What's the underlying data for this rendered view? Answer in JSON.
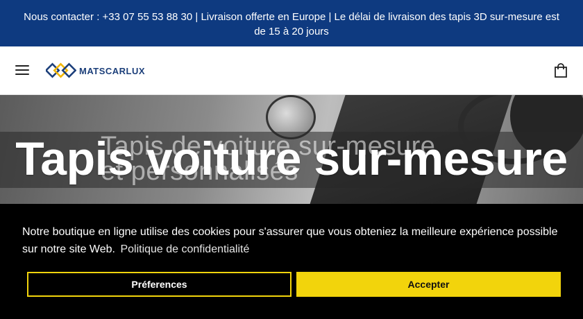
{
  "announcement": {
    "text": "Nous contacter : +33 07 55 53 88 30 | Livraison offerte en Europe | Le délai de livraison des tapis 3D sur-mesure est de 15 à 20 jours"
  },
  "header": {
    "menu_icon": "hamburger-icon",
    "logo_text": "MATSCARLUX",
    "cart_icon": "shopping-bag-icon"
  },
  "hero": {
    "title": "Tapis voiture sur-mesure",
    "background_title": "Tapis de voiture sur-mesure et personnalisés"
  },
  "cookie_banner": {
    "message": "Notre boutique en ligne utilise des cookies pour s'assurer que vous obteniez la meilleure expérience possible sur notre site Web.",
    "link_text": "Politique de confidentialité",
    "preferences_label": "Préferences",
    "accept_label": "Accepter"
  },
  "colors": {
    "announcement_bg": "#0e3a80",
    "accent_yellow": "#f2d40c",
    "logo_blue": "#1c3f7a"
  }
}
